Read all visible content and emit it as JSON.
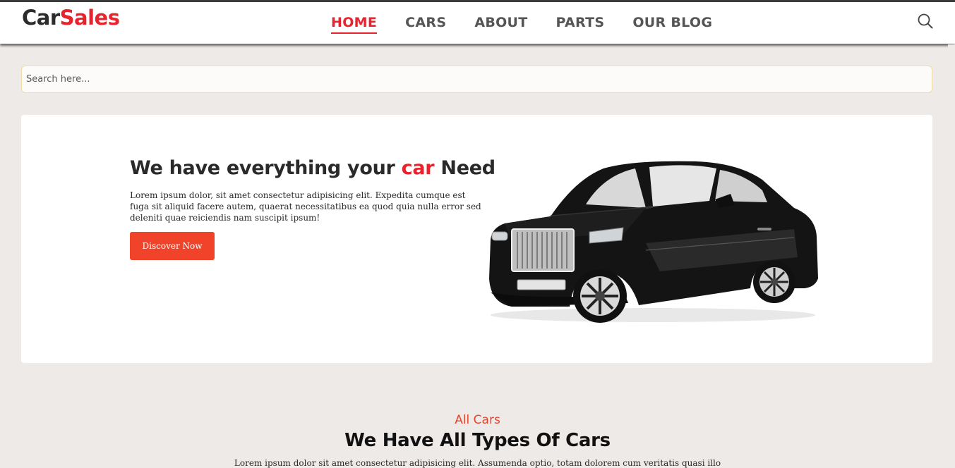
{
  "header": {
    "logo_part1": "Car",
    "logo_part2": "Sales",
    "nav": [
      {
        "label": "HOME",
        "active": true
      },
      {
        "label": "CARS",
        "active": false
      },
      {
        "label": "ABOUT",
        "active": false
      },
      {
        "label": "PARTS",
        "active": false
      },
      {
        "label": "OUR BLOG",
        "active": false
      }
    ],
    "search_icon": "search-icon"
  },
  "search": {
    "placeholder": "Search here..."
  },
  "hero": {
    "title_start": "We have everything your ",
    "title_accent": "car",
    "title_end": " Need",
    "text": "Lorem ipsum dolor, sit amet consectetur adipisicing elit. Expedita cumque est fuga sit aliquid facere autem, quaerat necessitatibus ea quod quia nulla error sed deleniti quae reiciendis nam suscipit ipsum!",
    "button_label": "Discover Now",
    "image": "black-luxury-sedan"
  },
  "section": {
    "subtitle": "All Cars",
    "title": "We Have All Types Of Cars",
    "text_cut": "Lorem ipsum dolor sit amet consectetur adipisicing elit. Assumenda optio, totam dolorem cum veritatis quasi illo"
  },
  "colors": {
    "accent": "#e8232d",
    "button": "#f0432a",
    "background": "#eeeae8"
  }
}
